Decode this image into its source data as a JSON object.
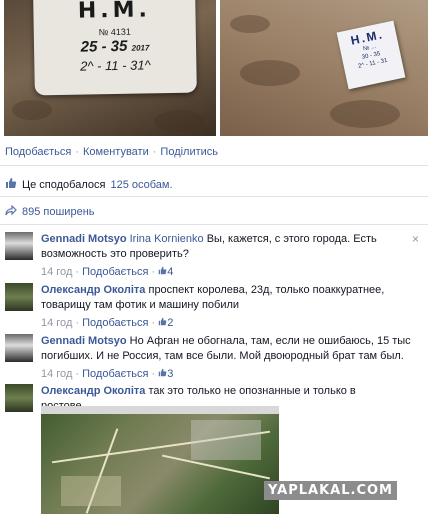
{
  "photo_left": {
    "sign_title": "Н.М.",
    "sign_num": "№ 4131",
    "sign_code": "25 - 35",
    "sign_code_suffix": "2017",
    "sign_date": "2^ - 11 - 31^"
  },
  "photo_right": {
    "sign_title": "Н.М.",
    "sign_lines": [
      "№ ...",
      "30 - 35",
      "2^ - 11 - 31"
    ]
  },
  "actions": {
    "like": "Подобається",
    "comment": "Коментувати",
    "share": "Поділитись",
    "sep": "·"
  },
  "likes": {
    "text": "Це сподобалося",
    "count": "125 особам."
  },
  "shares": {
    "text": "895 поширень"
  },
  "comments": [
    {
      "author": "Gennadi Motsyo",
      "tag": "Irina Kornienko",
      "text": "Вы, кажется, с этого города. Есть возможность это проверить?",
      "time": "14 год",
      "like": "Подобається",
      "likes": "4",
      "close": "×"
    },
    {
      "author": "Олександр Околіта",
      "text": "проспект королева, 23д, только поаккуратнее, товарищу там фотик и машину побили",
      "time": "14 год",
      "like": "Подобається",
      "likes": "2"
    },
    {
      "author": "Gennadi Motsyo",
      "text": "Но Афган не обогнала, там, если не ошибаюсь, 15 тыс погибших. И не Россия, там все были. Мой двоюродный брат там был.",
      "time": "14 год",
      "like": "Подобається",
      "likes": "3"
    },
    {
      "author": "Олександр Околіта",
      "text": "так это только не опознанные и только в ростове...."
    }
  ],
  "watermark": "YAPLAKAL.COM",
  "colors": {
    "link": "#3b5998",
    "meta": "#9197a3",
    "divider": "#e1e2e3"
  }
}
